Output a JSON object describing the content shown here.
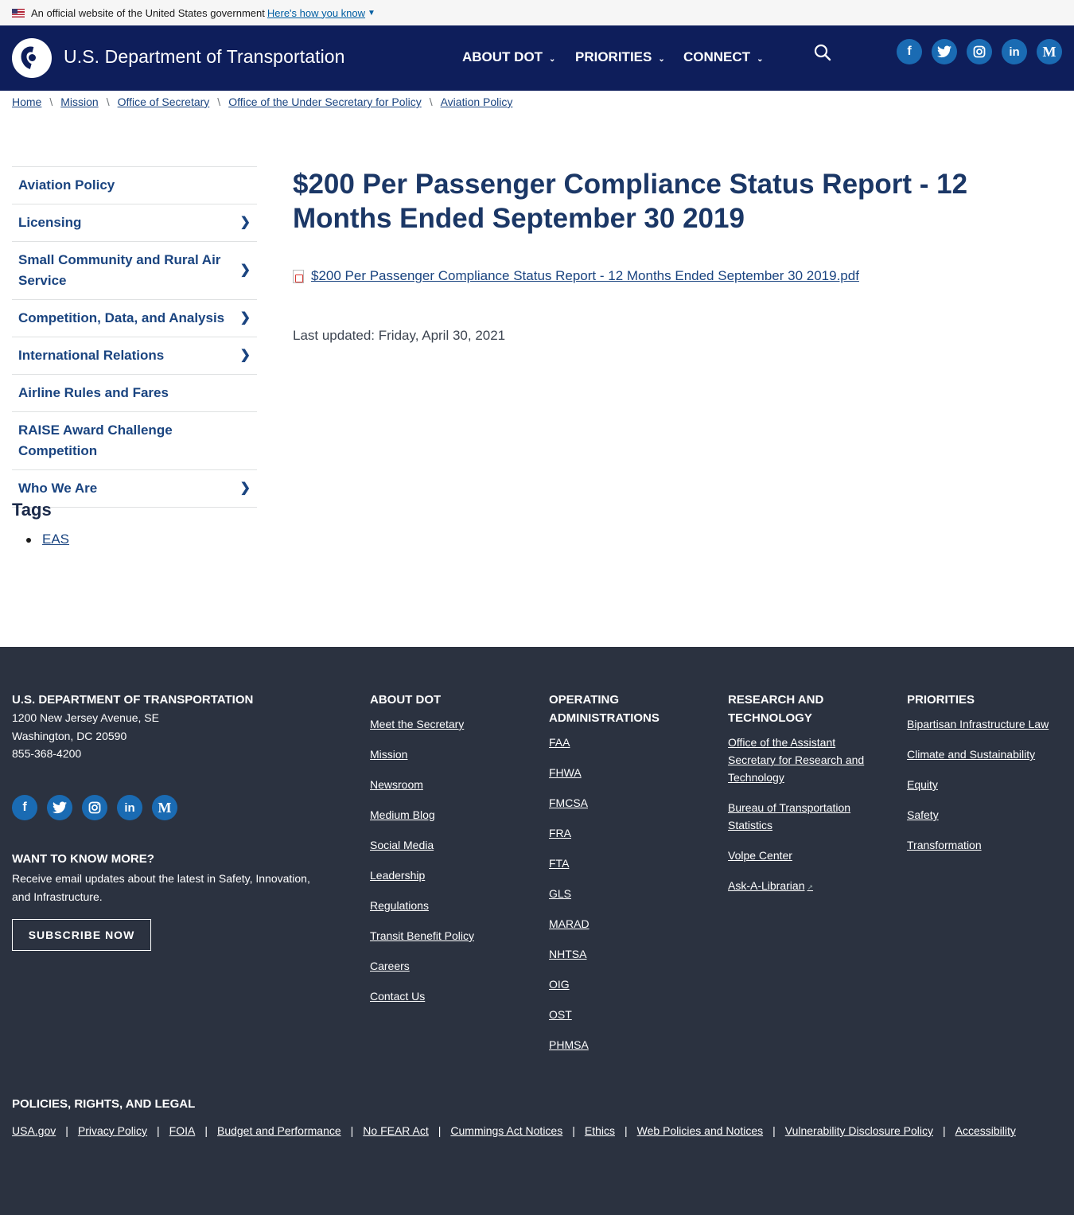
{
  "gov_banner": {
    "text": "An official website of the United States government",
    "link": "Here's how you know"
  },
  "header": {
    "title": "U.S. Department of Transportation",
    "nav": [
      {
        "label": "ABOUT DOT"
      },
      {
        "label": "PRIORITIES"
      },
      {
        "label": "CONNECT"
      }
    ],
    "social": [
      {
        "icon": "facebook-icon",
        "glyph": "f"
      },
      {
        "icon": "twitter-icon",
        "glyph": "🐦"
      },
      {
        "icon": "instagram-icon",
        "glyph": "◎"
      },
      {
        "icon": "linkedin-icon",
        "glyph": "in"
      },
      {
        "icon": "medium-icon",
        "glyph": "M"
      }
    ]
  },
  "breadcrumb": [
    "Home",
    "Mission",
    "Office of Secretary",
    "Office of the Under Secretary for Policy",
    "Aviation Policy"
  ],
  "sidebar": {
    "items": [
      {
        "label": "Aviation Policy",
        "has_arrow": false
      },
      {
        "label": "Licensing",
        "has_arrow": true
      },
      {
        "label": "Small Community and Rural Air Service",
        "has_arrow": true
      },
      {
        "label": "Competition, Data, and Analysis",
        "has_arrow": true
      },
      {
        "label": "International Relations",
        "has_arrow": true
      },
      {
        "label": "Airline Rules and Fares",
        "has_arrow": false
      },
      {
        "label": "RAISE Award Challenge Competition",
        "has_arrow": false
      },
      {
        "label": "Who We Are",
        "has_arrow": true
      }
    ],
    "tags_heading": "Tags",
    "tags": [
      "EAS"
    ]
  },
  "main": {
    "title": "$200 Per Passenger Compliance Status Report - 12 Months Ended September 30 2019",
    "file_link": "$200 Per Passenger Compliance Status Report - 12 Months Ended September 30 2019.pdf",
    "last_updated": "Last updated: Friday, April 30, 2021"
  },
  "footer": {
    "org": {
      "heading": "U.S. DEPARTMENT OF TRANSPORTATION",
      "address1": "1200 New Jersey Avenue, SE",
      "address2": "Washington, DC 20590",
      "phone": "855-368-4200"
    },
    "want_more": {
      "heading": "WANT TO KNOW MORE?",
      "text": "Receive email updates about the latest in Safety, Innovation, and Infrastructure.",
      "button": "SUBSCRIBE NOW"
    },
    "about": {
      "heading": "ABOUT DOT",
      "links": [
        "Meet the Secretary",
        "Mission",
        "Newsroom",
        "Medium Blog",
        "Social Media",
        "Leadership",
        "Regulations",
        "Transit Benefit Policy",
        "Careers",
        "Contact Us"
      ]
    },
    "operating": {
      "heading": "OPERATING ADMINISTRATIONS",
      "links": [
        "FAA",
        "FHWA",
        "FMCSA",
        "FRA",
        "FTA",
        "GLS",
        "MARAD",
        "NHTSA",
        "OIG",
        "OST",
        "PHMSA"
      ]
    },
    "research": {
      "heading": "RESEARCH AND TECHNOLOGY",
      "links": [
        "Office of the Assistant Secretary for Research and Technology",
        "Bureau of Transportation Statistics",
        "Volpe Center",
        "Ask-A-Librarian"
      ]
    },
    "priorities": {
      "heading": "PRIORITIES",
      "links": [
        "Bipartisan Infrastructure Law",
        "Climate and Sustainability",
        "Equity",
        "Safety",
        "Transformation"
      ]
    },
    "legal": {
      "heading": "POLICIES, RIGHTS, AND LEGAL",
      "links": [
        "USA.gov",
        "Privacy Policy",
        "FOIA",
        "Budget and Performance",
        "No FEAR Act",
        "Cummings Act Notices",
        "Ethics",
        "Web Policies and Notices",
        "Vulnerability Disclosure Policy",
        "Accessibility"
      ]
    }
  }
}
